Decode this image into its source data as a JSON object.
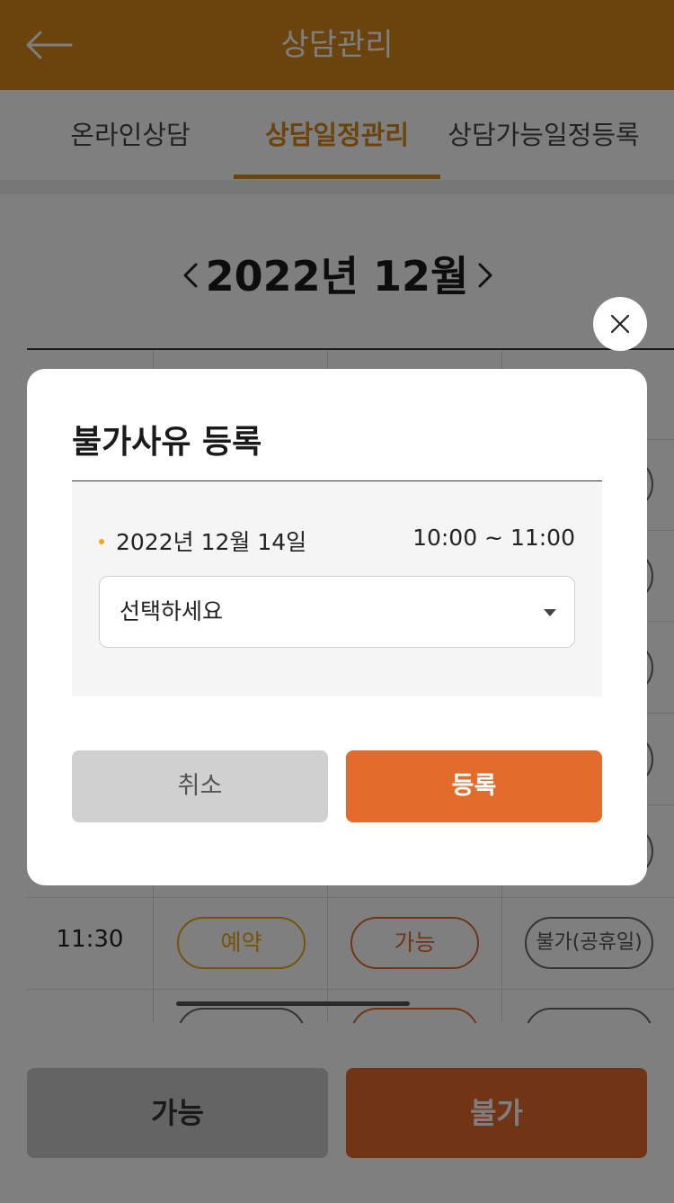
{
  "header": {
    "title": "상담관리",
    "back_icon": "arrow-left-icon",
    "bg_color": "#d4861a"
  },
  "tabs": [
    {
      "label": "온라인상담",
      "active": false
    },
    {
      "label": "상담일정관리",
      "active": true
    },
    {
      "label": "상담가능일정등록",
      "active": false
    }
  ],
  "calendar": {
    "month_label": "2022년 12월",
    "prev_icon": "chevron-left-icon",
    "next_icon": "chevron-right-icon"
  },
  "schedule": {
    "rows": [
      {
        "time": "11:30",
        "slots": [
          "예약",
          "가능",
          "불가(공휴일)"
        ]
      }
    ]
  },
  "bottom_actions": {
    "possible_label": "가능",
    "impossible_label": "불가"
  },
  "modal": {
    "title": "불가사유 등록",
    "date": "2022년 12월 14일",
    "time_range": "10:00  ~ 11:00",
    "reason_select": {
      "value": "선택하세요"
    },
    "cancel_label": "취소",
    "submit_label": "등록",
    "close_icon": "close-icon"
  },
  "colors": {
    "accent": "#e36b2c",
    "header": "#d4861a",
    "reserve": "#e8a818"
  }
}
